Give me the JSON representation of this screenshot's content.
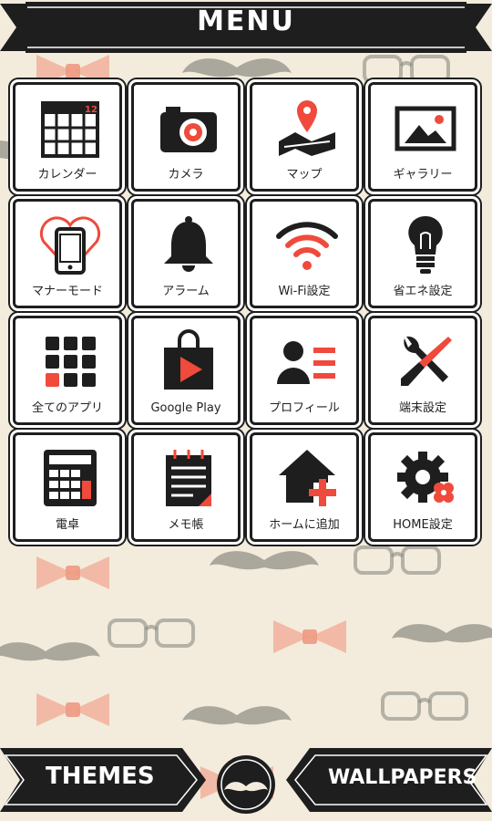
{
  "header": {
    "title": "MENU"
  },
  "tiles": [
    {
      "label": "カレンダー",
      "icon": "calendar-icon",
      "badge": "12"
    },
    {
      "label": "カメラ",
      "icon": "camera-icon"
    },
    {
      "label": "マップ",
      "icon": "map-icon"
    },
    {
      "label": "ギャラリー",
      "icon": "gallery-icon"
    },
    {
      "label": "マナーモード",
      "icon": "manner-mode-icon"
    },
    {
      "label": "アラーム",
      "icon": "alarm-bell-icon"
    },
    {
      "label": "Wi-Fi設定",
      "icon": "wifi-icon"
    },
    {
      "label": "省エネ設定",
      "icon": "lightbulb-icon"
    },
    {
      "label": "全てのアプリ",
      "icon": "all-apps-icon"
    },
    {
      "label": "Google Play",
      "icon": "google-play-icon"
    },
    {
      "label": "プロフィール",
      "icon": "profile-icon"
    },
    {
      "label": "端末設定",
      "icon": "device-settings-icon"
    },
    {
      "label": "電卓",
      "icon": "calculator-icon"
    },
    {
      "label": "メモ帳",
      "icon": "notepad-icon"
    },
    {
      "label": "ホームに追加",
      "icon": "add-home-icon"
    },
    {
      "label": "HOME設定",
      "icon": "home-settings-icon"
    }
  ],
  "footer": {
    "themes_label": "THEMES",
    "wallpapers_label": "WALLPAPERS"
  },
  "colors": {
    "accent": "#ef4a3c",
    "dark": "#1e1e1e",
    "background": "#f3ecdc",
    "bowtie": "#f1a994",
    "mustache": "#8a8a82"
  }
}
